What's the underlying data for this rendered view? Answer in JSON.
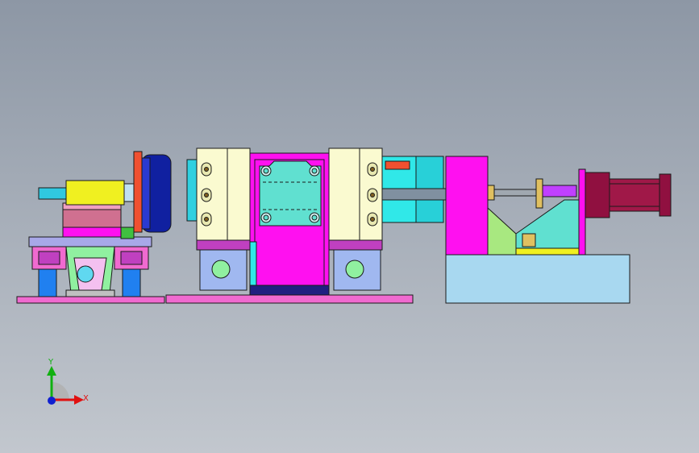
{
  "viewport": {
    "background_top": "#8d97a5",
    "background_bottom": "#c2c7ce"
  },
  "triad": {
    "x_label": "X",
    "y_label": "Y",
    "x_color": "#e01010",
    "y_color": "#10b010",
    "z_color": "#1020d0"
  },
  "palette": {
    "outline": "#1a1a1a",
    "base_pink": "#f06ad0",
    "magenta": "#ff10f0",
    "purple": "#c040c0",
    "cream": "#fafad0",
    "cyan": "#30e8e8",
    "aqua": "#60e0d0",
    "blue": "#1020a0",
    "navy": "#202080",
    "yellow": "#f0f020",
    "rose": "#d07090",
    "lilac": "#c0a8e8",
    "lavender_blue": "#a0b8f0",
    "light_blue": "#a8d8f0",
    "green": "#90f0a0",
    "lime": "#a8e880",
    "orange": "#f05030",
    "maroon": "#901040",
    "gold": "#e0c060",
    "steel": "#8090a0"
  }
}
